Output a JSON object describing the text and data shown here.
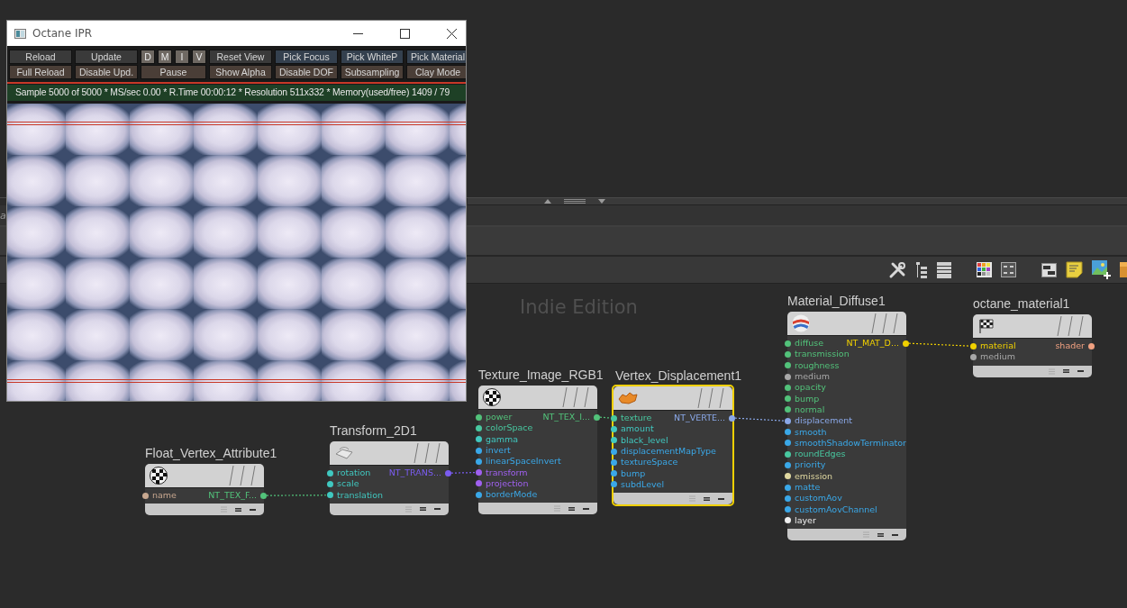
{
  "ipr_window": {
    "title": "Octane IPR",
    "button_rows": [
      [
        {
          "label": "Reload",
          "kind": "plain"
        },
        {
          "label": "Update",
          "kind": "plain"
        },
        {
          "label": "D",
          "kind": "toggle"
        },
        {
          "label": "M",
          "kind": "toggle"
        },
        {
          "label": "I",
          "kind": "toggle"
        },
        {
          "label": "V",
          "kind": "toggle"
        },
        {
          "label": "Reset View",
          "kind": "plain"
        },
        {
          "label": "Pick Focus",
          "kind": "pick"
        },
        {
          "label": "Pick WhiteP",
          "kind": "pick"
        },
        {
          "label": "Pick Material",
          "kind": "pick"
        }
      ],
      [
        {
          "label": "Full Reload",
          "kind": "option"
        },
        {
          "label": "Disable Upd.",
          "kind": "option"
        },
        {
          "label": "Pause",
          "kind": "wide"
        },
        {
          "label": "Show Alpha",
          "kind": "option"
        },
        {
          "label": "Disable DOF",
          "kind": "option"
        },
        {
          "label": "Subsampling",
          "kind": "option"
        },
        {
          "label": "Clay Mode",
          "kind": "option"
        }
      ]
    ],
    "status": "Sample 5000 of 5000 * MS/sec 0.00 * R.Time 00:00:12 * Resolution 511x332 * Memory(used/free) 1409 / 79"
  },
  "side_panel": {
    "text": "a"
  },
  "canvas": {
    "label": "Indie Edition"
  },
  "nodes": [
    {
      "title": "Float_Vertex_Attribute1",
      "kind": "checker",
      "selected": false,
      "inputs": [
        {
          "name": "name",
          "color": "#c8a890"
        }
      ],
      "output": {
        "label": "NT_TEX_F...",
        "color": "#52c27a"
      }
    },
    {
      "title": "Transform_2D1",
      "kind": "transform",
      "selected": false,
      "inputs": [
        {
          "name": "rotation",
          "color": "#40c8c0"
        },
        {
          "name": "scale",
          "color": "#40c8c0"
        },
        {
          "name": "translation",
          "color": "#40c8c0",
          "connected": true
        }
      ],
      "output": {
        "label": "NT_TRANS...",
        "color": "#7a5cf0"
      }
    },
    {
      "title": "Texture_Image_RGB1",
      "kind": "checker",
      "selected": false,
      "inputs": [
        {
          "name": "power",
          "color": "#52c27a"
        },
        {
          "name": "colorSpace",
          "color": "#48c8a0"
        },
        {
          "name": "gamma",
          "color": "#40c8c0"
        },
        {
          "name": "invert",
          "color": "#3aa8e8"
        },
        {
          "name": "linearSpaceInvert",
          "color": "#3aa8e8"
        },
        {
          "name": "transform",
          "color": "#a060f0",
          "connected": true
        },
        {
          "name": "projection",
          "color": "#a060f0"
        },
        {
          "name": "borderMode",
          "color": "#3aa8e8"
        }
      ],
      "output": {
        "label": "NT_TEX_I...",
        "color": "#52c27a"
      }
    },
    {
      "title": "Vertex_Displacement1",
      "kind": "displacement",
      "selected": true,
      "inputs": [
        {
          "name": "texture",
          "color": "#48c8a0",
          "connected": true
        },
        {
          "name": "amount",
          "color": "#40c8c0"
        },
        {
          "name": "black_level",
          "color": "#40c8c0"
        },
        {
          "name": "displacementMapType",
          "color": "#3aa8e8"
        },
        {
          "name": "textureSpace",
          "color": "#3aa8e8"
        },
        {
          "name": "bump",
          "color": "#3aa8e8"
        },
        {
          "name": "subdLevel",
          "color": "#3aa8e8"
        }
      ],
      "output": {
        "label": "NT_VERTE...",
        "color": "#8aa8e8"
      }
    },
    {
      "title": "Material_Diffuse1",
      "kind": "material",
      "selected": false,
      "inputs": [
        {
          "name": "diffuse",
          "color": "#52c27a"
        },
        {
          "name": "transmission",
          "color": "#52c27a"
        },
        {
          "name": "roughness",
          "color": "#52c27a"
        },
        {
          "name": "medium",
          "color": "#a8a8a8"
        },
        {
          "name": "opacity",
          "color": "#52c27a"
        },
        {
          "name": "bump",
          "color": "#52c27a"
        },
        {
          "name": "normal",
          "color": "#52c27a"
        },
        {
          "name": "displacement",
          "color": "#8aa8e8",
          "connected": true
        },
        {
          "name": "smooth",
          "color": "#3aa8e8"
        },
        {
          "name": "smoothShadowTerminator",
          "color": "#3aa8e8"
        },
        {
          "name": "roundEdges",
          "color": "#48c8a0"
        },
        {
          "name": "priority",
          "color": "#3aa8e8"
        },
        {
          "name": "emission",
          "color": "#e0d8a0"
        },
        {
          "name": "matte",
          "color": "#3aa8e8"
        },
        {
          "name": "customAov",
          "color": "#3aa8e8"
        },
        {
          "name": "customAovChannel",
          "color": "#3aa8e8"
        },
        {
          "name": "layer",
          "color": "#f0f0f0"
        }
      ],
      "output": {
        "label": "NT_MAT_D...",
        "color": "#f0d000"
      }
    },
    {
      "title": "octane_material1",
      "kind": "output",
      "selected": false,
      "inputs": [
        {
          "name": "material",
          "color": "#f0d000",
          "connected": true
        },
        {
          "name": "medium",
          "color": "#a8a8a8"
        }
      ],
      "output": {
        "label": "shader",
        "color": "#f0a080"
      }
    }
  ]
}
